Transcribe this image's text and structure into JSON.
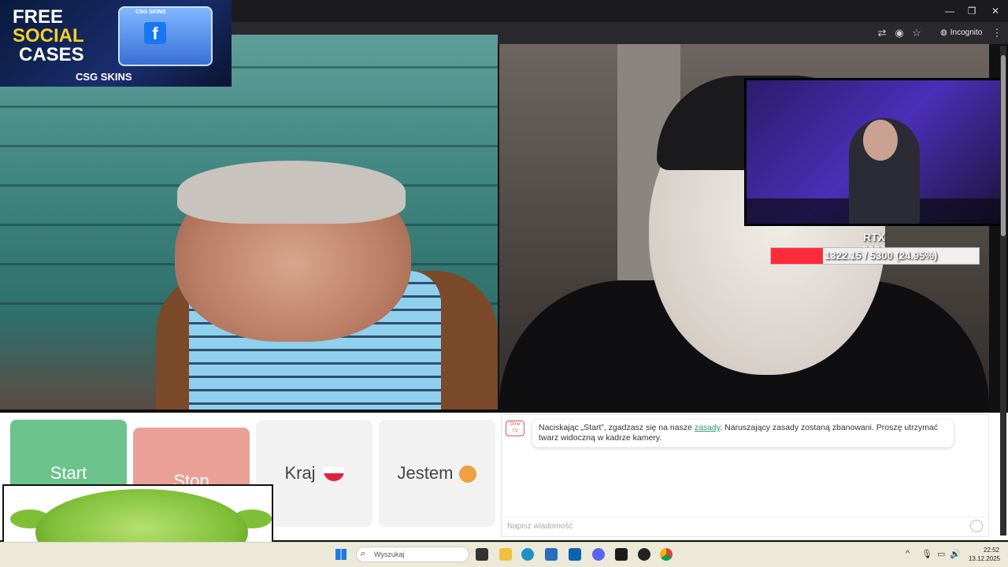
{
  "browser": {
    "incognito_label": "Incognito",
    "window_controls": [
      "minimize",
      "restore",
      "close"
    ]
  },
  "ad": {
    "line1": "FREE",
    "line2": "SOCIAL",
    "line3": "CASES",
    "case_badge": "CSG SKINS",
    "brand": "CSG SKINS"
  },
  "overlay": {
    "gpu_name": "RTX 5080",
    "gpu_progress_text": "1322.15 / 5300 (24.95%)",
    "gpu_progress": 0.2495
  },
  "controls": {
    "start_label": "Start",
    "stop_label": "Stop",
    "country_label": "Kraj",
    "gender_label": "Jestem"
  },
  "chat": {
    "logo_text": "Ome TV",
    "message_prefix": "Naciskając „Start”, zgadzasz się na nasze ",
    "rules_link": "zasady",
    "message_suffix": ". Naruszający zasady zostaną zbanowani. Proszę utrzymać twarz widoczną w kadrze kamery.",
    "input_placeholder": "Napisz wiadomość"
  },
  "taskbar": {
    "search_placeholder": "Wyszukaj",
    "time": "22:52",
    "date": "13.12.2025"
  },
  "colors": {
    "start_button": "#6ac48b",
    "stop_button": "#e9a197",
    "link": "#2e9a6b",
    "gpu_fill": "#ff2a3a"
  }
}
